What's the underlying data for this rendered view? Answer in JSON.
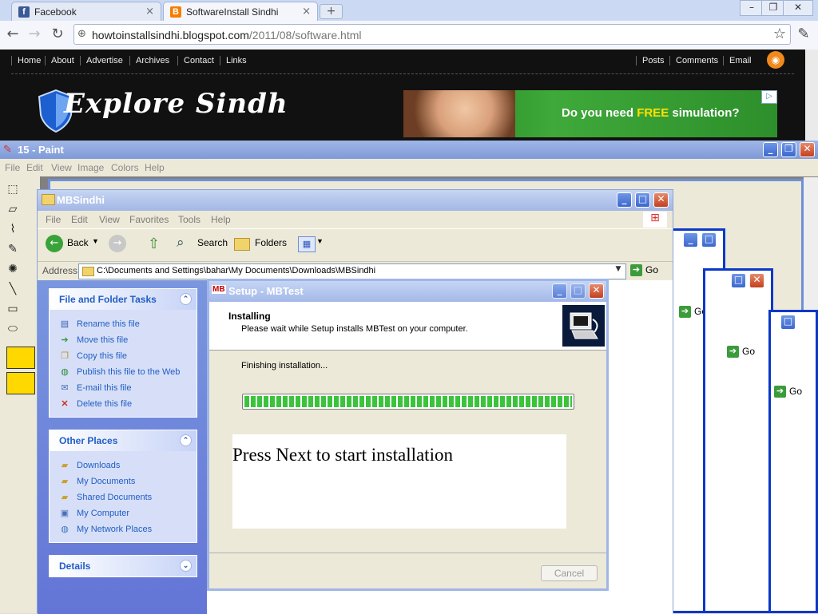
{
  "browser": {
    "tabs": [
      {
        "title": "Facebook",
        "favicon": "f",
        "color": "#3b5998"
      },
      {
        "title": "SoftwareInstall Sindhi",
        "favicon": "B",
        "color": "#f57d00"
      }
    ],
    "url_host": "howtoinstallsindhi.blogspot.com",
    "url_path": "/2011/08/software.html"
  },
  "blog": {
    "nav_left": [
      "Home",
      "About",
      "Advertise",
      "Archives",
      "Contact",
      "Links"
    ],
    "nav_right": [
      "Posts",
      "Comments",
      "Email"
    ],
    "logo_text": "Explore Sindh",
    "ad_text_pre": "Do you need ",
    "ad_text_highlight": "FREE",
    "ad_text_post": " simulation?"
  },
  "paint": {
    "title": "15 - Paint",
    "menu": [
      "File",
      "Edit",
      "View",
      "Image",
      "Colors",
      "Help"
    ]
  },
  "explorer": {
    "title": "MBSindhi",
    "menu": [
      "File",
      "Edit",
      "View",
      "Favorites",
      "Tools",
      "Help"
    ],
    "toolbar": {
      "back": "Back",
      "search": "Search",
      "folders": "Folders"
    },
    "address_label": "Address",
    "address_value": "C:\\Documents and Settings\\bahar\\My Documents\\Downloads\\MBSindhi",
    "go": "Go",
    "file_tasks": {
      "title": "File and Folder Tasks",
      "items": [
        "Rename this file",
        "Move this file",
        "Copy this file",
        "Publish this file to the Web",
        "E-mail this file",
        "Delete this file"
      ]
    },
    "other_places": {
      "title": "Other Places",
      "items": [
        "Downloads",
        "My Documents",
        "Shared Documents",
        "My Computer",
        "My Network Places"
      ]
    },
    "details": {
      "title": "Details"
    }
  },
  "setup": {
    "title": "Setup - MBTest",
    "heading": "Installing",
    "subheading": "Please wait while Setup installs MBTest on your computer.",
    "status": "Finishing installation...",
    "progress": 1.0,
    "notice": "Press Next to start installation",
    "cancel": "Cancel"
  }
}
